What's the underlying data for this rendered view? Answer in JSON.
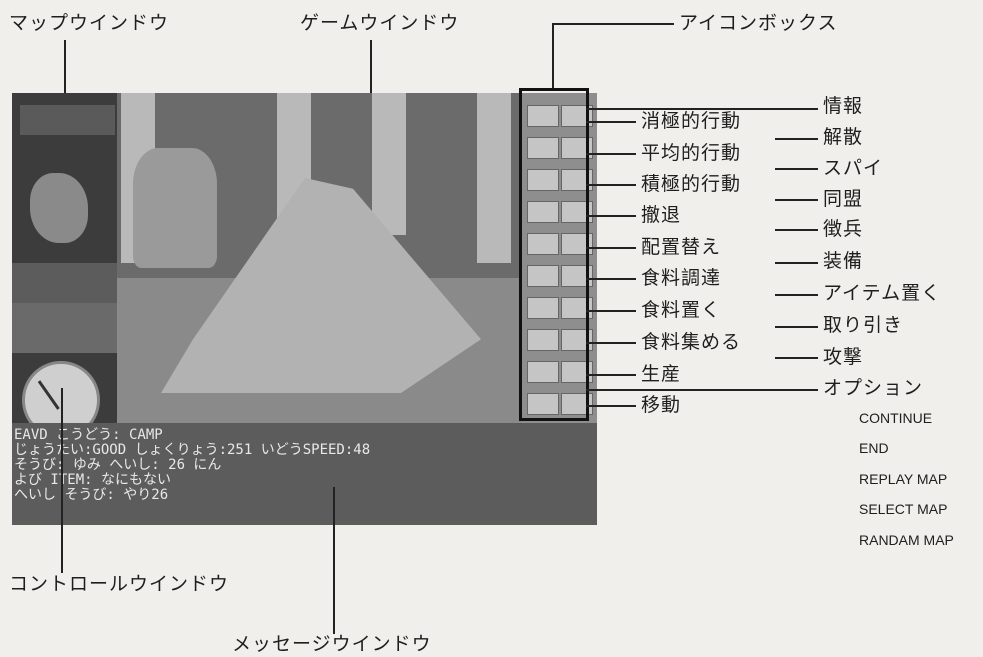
{
  "callouts": {
    "map_window": "マップウインドウ",
    "game_window": "ゲームウインドウ",
    "icon_box": "アイコンボックス",
    "control_window": "コントロールウインドウ",
    "message_window": "メッセージウインドウ"
  },
  "left_icon_labels": [
    "消極的行動",
    "平均的行動",
    "積極的行動",
    "撤退",
    "配置替え",
    "食料調達",
    "食料置く",
    "食料集める",
    "生産",
    "移動"
  ],
  "right_icon_labels": [
    "情報",
    "解散",
    "スパイ",
    "同盟",
    "徴兵",
    "装備",
    "アイテム置く",
    "取り引き",
    "攻撃",
    "オプション"
  ],
  "option_submenu": [
    "CONTINUE",
    "END",
    "REPLAY MAP",
    "SELECT MAP",
    "RANDAM MAP"
  ],
  "message_lines": [
    "EAVD こうどう: CAMP",
    "じょうたい:GOOD しょくりょう:251 いどうSPEED:48",
    "そうび: ゆみ へいし: 26 にん",
    "よび ITEM: なにもない",
    "へいし そうび: やり26"
  ]
}
